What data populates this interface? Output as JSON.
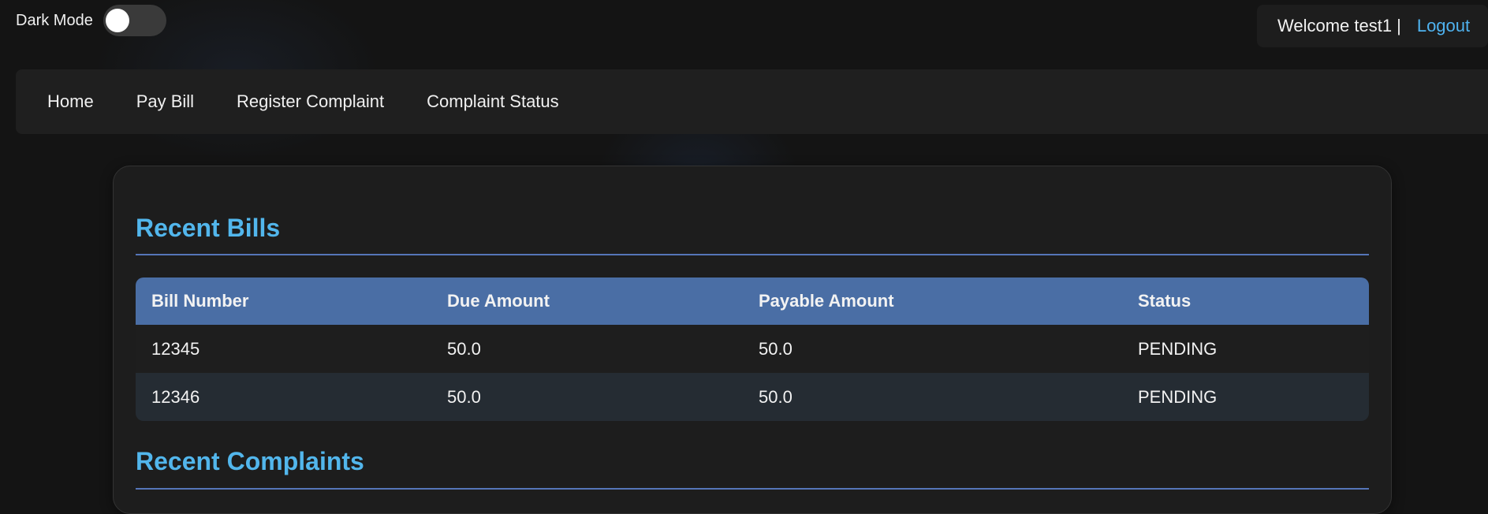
{
  "dark_mode": {
    "label": "Dark Mode",
    "enabled": false
  },
  "user": {
    "welcome": "Welcome test1",
    "separator": "|",
    "logout": "Logout"
  },
  "nav": {
    "items": [
      "Home",
      "Pay Bill",
      "Register Complaint",
      "Complaint Status"
    ]
  },
  "bills": {
    "title": "Recent Bills",
    "columns": [
      "Bill Number",
      "Due Amount",
      "Payable Amount",
      "Status"
    ],
    "rows": [
      [
        "12345",
        "50.0",
        "50.0",
        "PENDING"
      ],
      [
        "12346",
        "50.0",
        "50.0",
        "PENDING"
      ]
    ]
  },
  "complaints": {
    "title": "Recent Complaints"
  },
  "colors": {
    "accent": "#52b6ec",
    "table_header": "#4a6ea5",
    "logout_link": "#4fb3f0",
    "background": "#141414"
  }
}
